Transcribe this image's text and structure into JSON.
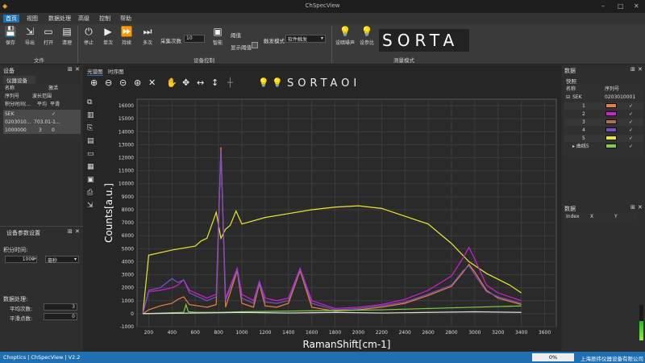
{
  "app": {
    "title": "ChSpecView"
  },
  "menu": [
    "首页",
    "视图",
    "数据处理",
    "高级",
    "控制",
    "帮助"
  ],
  "ribbon": {
    "file": {
      "save": "保存",
      "export": "导出",
      "open": "打开",
      "clear": "清理",
      "group": "文件"
    },
    "control": {
      "stop": "停止",
      "single": "单次",
      "continuous": "持续",
      "multi": "多次",
      "count_label": "采集次数",
      "count_value": "10",
      "smart": "智能",
      "threshold": "阈值",
      "show_threshold": "显示阈值",
      "trigger_mode": "触发模式",
      "trigger_value": "软件触发",
      "group": "设备控制"
    },
    "measure": {
      "dark": "设暗噪声",
      "ref": "设参比",
      "sorta": "SORTA",
      "group": "测量模式"
    }
  },
  "left": {
    "title": "设备",
    "tab": "仪器设备",
    "table_headers": [
      "名称",
      "激活",
      "序列号",
      "波长范围",
      "积分时间(...",
      "平均",
      "平滑"
    ],
    "device": {
      "name": "SEK",
      "serial": "0203010...",
      "wave": "703.01-1...",
      "int": "1000000",
      "avg": "3",
      "smooth": "0"
    },
    "params_title": "设备参数设置",
    "int_label": "积分时间:",
    "int_value": "1000",
    "int_unit": "毫秒",
    "proc_label": "数据处理:",
    "avg_label": "平均次数:",
    "avg_value": "3",
    "smooth_label": "平滑点数:",
    "smooth_value": "0"
  },
  "tabs": [
    "光谱图",
    "时序图"
  ],
  "chart_toolbar": {
    "sorta": "SORTAOI"
  },
  "right": {
    "title": "数据",
    "tab": "快照",
    "headers": [
      "名称",
      "序列号"
    ],
    "root": "SEK",
    "serial": "0203010001",
    "rows": [
      {
        "name": "1",
        "color": "#e8823a"
      },
      {
        "name": "2",
        "color": "#d020d0"
      },
      {
        "name": "3",
        "color": "#b07050"
      },
      {
        "name": "4",
        "color": "#7a50c8"
      },
      {
        "name": "5",
        "color": "#e8e830"
      },
      {
        "name": "曲线5",
        "color": "#80d040"
      }
    ],
    "data_title": "数据",
    "data_headers": [
      "Index",
      "X",
      "Y"
    ]
  },
  "status": {
    "left": "Choptics | ChSpecView | V2.2",
    "progress": "0%",
    "company": "上海辰纬仪器设备有限公司"
  },
  "chart_data": {
    "type": "line",
    "xlabel": "RamanShift[cm-1]",
    "ylabel": "Counts[a.u.]",
    "xlim": [
      100,
      3700
    ],
    "ylim": [
      -1000,
      16500
    ],
    "xticks": [
      200,
      400,
      600,
      800,
      1000,
      1200,
      1400,
      1600,
      1800,
      2000,
      2200,
      2400,
      2600,
      2800,
      3000,
      3200,
      3400,
      3600
    ],
    "yticks": [
      -1000,
      0,
      1000,
      2000,
      3000,
      4000,
      5000,
      6000,
      7000,
      8000,
      9000,
      10000,
      11000,
      12000,
      13000,
      14000,
      15000,
      16000
    ],
    "series": [
      {
        "color": "#e8e830",
        "x": [
          150,
          200,
          400,
          600,
          650,
          700,
          780,
          820,
          860,
          900,
          950,
          1000,
          1200,
          1400,
          1600,
          1800,
          2000,
          2200,
          2400,
          2600,
          2800,
          2950,
          3100,
          3300,
          3400
        ],
        "y": [
          0,
          4500,
          4900,
          5200,
          5600,
          5800,
          7800,
          5800,
          6500,
          6800,
          7900,
          6900,
          7400,
          7700,
          8000,
          8200,
          8300,
          8100,
          7500,
          6900,
          5400,
          4000,
          3100,
          2200,
          1600
        ]
      },
      {
        "color": "#d020d0",
        "x": [
          150,
          200,
          300,
          400,
          450,
          500,
          550,
          700,
          780,
          820,
          860,
          960,
          1000,
          1100,
          1150,
          1200,
          1300,
          1400,
          1500,
          1600,
          1800,
          2000,
          2200,
          2400,
          2600,
          2800,
          2900,
          2950,
          3000,
          3100,
          3200,
          3400
        ],
        "y": [
          0,
          1700,
          1800,
          2000,
          2200,
          2600,
          1800,
          1200,
          1500,
          12800,
          1200,
          3500,
          1500,
          1000,
          2500,
          1200,
          1000,
          1200,
          3500,
          1000,
          400,
          500,
          700,
          1100,
          1800,
          2900,
          4300,
          5100,
          4200,
          2200,
          1600,
          1000
        ]
      },
      {
        "color": "#e8823a",
        "x": [
          150,
          200,
          300,
          400,
          450,
          500,
          550,
          700,
          780,
          820,
          860,
          960,
          1000,
          1100,
          1150,
          1200,
          1300,
          1400,
          1500,
          1600,
          1800,
          2000,
          2200,
          2400,
          2600,
          2800,
          2900,
          2950,
          3000,
          3100,
          3200,
          3400
        ],
        "y": [
          0,
          300,
          600,
          800,
          1100,
          1300,
          700,
          500,
          700,
          12800,
          500,
          3300,
          800,
          500,
          2300,
          600,
          500,
          800,
          3300,
          500,
          200,
          300,
          500,
          800,
          1400,
          2100,
          3200,
          3800,
          3200,
          1800,
          1200,
          700
        ]
      },
      {
        "color": "#7a50c8",
        "x": [
          150,
          200,
          300,
          400,
          450,
          500,
          550,
          700,
          780,
          820,
          860,
          960,
          1000,
          1100,
          1150,
          1200,
          1300,
          1400,
          1500,
          1600,
          1800,
          2000,
          2200,
          2400,
          2600,
          2800,
          2900,
          2950,
          3000,
          3100,
          3200,
          3400
        ],
        "y": [
          0,
          1800,
          2000,
          2700,
          2400,
          2600,
          1600,
          1000,
          1300,
          12600,
          1000,
          3400,
          1200,
          800,
          2400,
          900,
          800,
          1000,
          3400,
          800,
          300,
          400,
          600,
          900,
          1500,
          2200,
          3300,
          3700,
          3000,
          1700,
          1300,
          800
        ]
      },
      {
        "color": "#80d040",
        "x": [
          150,
          300,
          500,
          520,
          540,
          600,
          800,
          1000,
          1400,
          1800,
          2200,
          2600,
          3000,
          3400
        ],
        "y": [
          0,
          50,
          100,
          700,
          150,
          100,
          100,
          150,
          200,
          250,
          300,
          400,
          500,
          600
        ]
      },
      {
        "color": "#dddddd",
        "x": [
          150,
          600,
          1000,
          1400,
          1800,
          2200,
          2600,
          3000,
          3400
        ],
        "y": [
          0,
          50,
          100,
          50,
          100,
          50,
          100,
          150,
          100
        ]
      }
    ]
  }
}
